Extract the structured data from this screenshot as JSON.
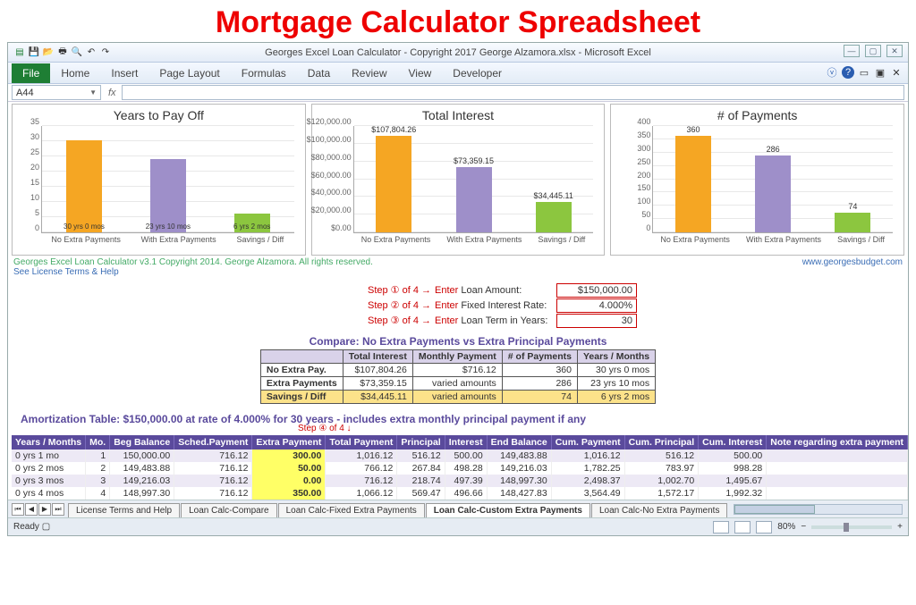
{
  "page_heading": "Mortgage Calculator Spreadsheet",
  "title": "Georges Excel Loan Calculator -  Copyright 2017 George Alzamora.xlsx  -  Microsoft Excel",
  "ribbon": {
    "file": "File",
    "tabs": [
      "Home",
      "Insert",
      "Page Layout",
      "Formulas",
      "Data",
      "Review",
      "View",
      "Developer"
    ]
  },
  "name_box": "A44",
  "credits": {
    "left1": "Georges Excel Loan Calculator v3.1   Copyright 2014. George Alzamora. All rights reserved.",
    "left2": "See License Terms & Help",
    "right": "www.georgesbudget.com"
  },
  "steps": {
    "s1_left": "Step ① of 4 →",
    "s1_enter": "Enter",
    "s1_label": "Loan Amount:",
    "s1_val": "$150,000.00",
    "s2_left": "Step ② of 4 →",
    "s2_enter": "Enter",
    "s2_label": "Fixed Interest Rate:",
    "s2_val": "4.000%",
    "s3_left": "Step ③ of 4 →",
    "s3_enter": "Enter",
    "s3_label": "Loan Term in Years:",
    "s3_val": "30"
  },
  "compare": {
    "title": "Compare: No Extra Payments vs Extra Principal Payments",
    "headers": [
      "",
      "Total Interest",
      "Monthly Payment",
      "# of Payments",
      "Years / Months"
    ],
    "rows": [
      [
        "No Extra Pay.",
        "$107,804.26",
        "$716.12",
        "360",
        "30 yrs 0 mos"
      ],
      [
        "Extra Payments",
        "$73,359.15",
        "varied amounts",
        "286",
        "23 yrs 10 mos"
      ],
      [
        "Savings / Diff",
        "$34,445.11",
        "varied amounts",
        "74",
        "6 yrs 2 mos"
      ]
    ]
  },
  "amort": {
    "title": "Amortization Table:  $150,000.00 at rate of 4.000% for 30 years - includes extra monthly principal payment if any",
    "step4": "Step ④ of 4 ↓",
    "headers": [
      "Years / Months",
      "Mo.",
      "Beg Balance",
      "Sched.Payment",
      "Extra Payment",
      "Total Payment",
      "Principal",
      "Interest",
      "End Balance",
      "Cum. Payment",
      "Cum. Principal",
      "Cum. Interest",
      "Note regarding extra payment"
    ],
    "rows": [
      [
        "0 yrs 1 mo",
        "1",
        "150,000.00",
        "716.12",
        "300.00",
        "1,016.12",
        "516.12",
        "500.00",
        "149,483.88",
        "1,016.12",
        "516.12",
        "500.00",
        ""
      ],
      [
        "0 yrs 2 mos",
        "2",
        "149,483.88",
        "716.12",
        "50.00",
        "766.12",
        "267.84",
        "498.28",
        "149,216.03",
        "1,782.25",
        "783.97",
        "998.28",
        ""
      ],
      [
        "0 yrs 3 mos",
        "3",
        "149,216.03",
        "716.12",
        "0.00",
        "716.12",
        "218.74",
        "497.39",
        "148,997.30",
        "2,498.37",
        "1,002.70",
        "1,495.67",
        ""
      ],
      [
        "0 yrs 4 mos",
        "4",
        "148,997.30",
        "716.12",
        "350.00",
        "1,066.12",
        "569.47",
        "496.66",
        "148,427.83",
        "3,564.49",
        "1,572.17",
        "1,992.32",
        ""
      ]
    ]
  },
  "sheet_tabs": [
    "License Terms and Help",
    "Loan Calc-Compare",
    "Loan Calc-Fixed Extra Payments",
    "Loan Calc-Custom Extra Payments",
    "Loan Calc-No Extra Payments"
  ],
  "status": {
    "ready": "Ready",
    "zoom": "80%"
  },
  "chart_data": [
    {
      "type": "bar",
      "title": "Years to Pay Off",
      "categories": [
        "No Extra Payments",
        "With Extra Payments",
        "Savings / Diff"
      ],
      "values": [
        30,
        23.83,
        6.17
      ],
      "value_labels": [
        "30 yrs 0 mos",
        "23 yrs 10 mos",
        "6 yrs 2 mos"
      ],
      "ylim": [
        0,
        35
      ],
      "yticks": [
        0,
        5,
        10,
        15,
        20,
        25,
        30,
        35
      ],
      "label_pos": "inside"
    },
    {
      "type": "bar",
      "title": "Total Interest",
      "categories": [
        "No Extra Payments",
        "With Extra Payments",
        "Savings / Diff"
      ],
      "values": [
        107804.26,
        73359.15,
        34445.11
      ],
      "value_labels": [
        "$107,804.26",
        "$73,359.15",
        "$34,445.11"
      ],
      "ylim": [
        0,
        120000
      ],
      "yticks": [
        0,
        20000,
        40000,
        60000,
        80000,
        100000,
        120000
      ],
      "ytick_labels": [
        "$0.00",
        "$20,000.00",
        "$40,000.00",
        "$60,000.00",
        "$80,000.00",
        "$100,000.00",
        "$120,000.00"
      ],
      "label_pos": "above"
    },
    {
      "type": "bar",
      "title": "# of Payments",
      "categories": [
        "No Extra Payments",
        "With Extra Payments",
        "Savings / Diff"
      ],
      "values": [
        360,
        286,
        74
      ],
      "value_labels": [
        "360",
        "286",
        "74"
      ],
      "ylim": [
        0,
        400
      ],
      "yticks": [
        0,
        50,
        100,
        150,
        200,
        250,
        300,
        350,
        400
      ],
      "label_pos": "above"
    }
  ]
}
